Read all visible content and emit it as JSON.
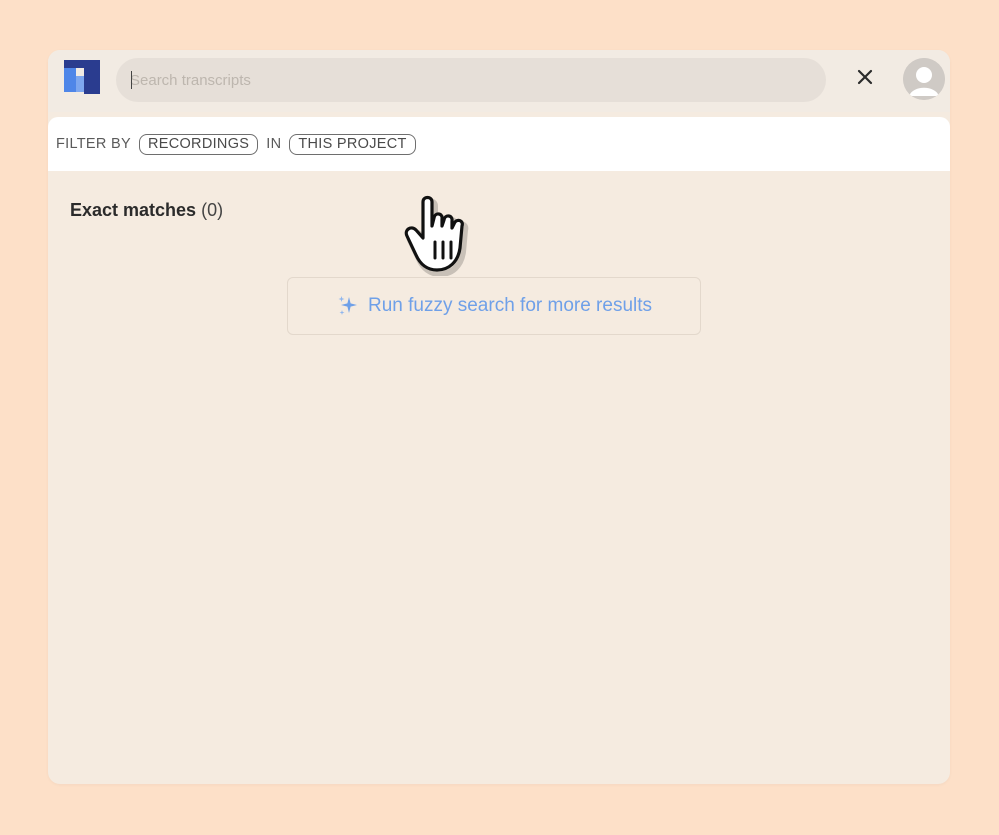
{
  "search": {
    "placeholder": "Search transcripts",
    "value": ""
  },
  "filter": {
    "label": "FILTER BY",
    "type_chip": "RECORDINGS",
    "connector": "IN",
    "scope_chip": "THIS PROJECT"
  },
  "results": {
    "title": "Exact matches",
    "count": "(0)"
  },
  "fuzzy": {
    "label": "Run fuzzy search for more results"
  },
  "colors": {
    "background": "#fde0c8",
    "panel": "#f5ebe0",
    "accent": "#6fa0e8",
    "logo_dark": "#2a3c8f",
    "logo_light": "#4f86e8"
  },
  "icons": {
    "logo": "app-logo-icon",
    "close": "close-icon",
    "avatar": "avatar-icon",
    "sparkle": "sparkle-icon",
    "cursor": "hand-pointer-icon"
  }
}
